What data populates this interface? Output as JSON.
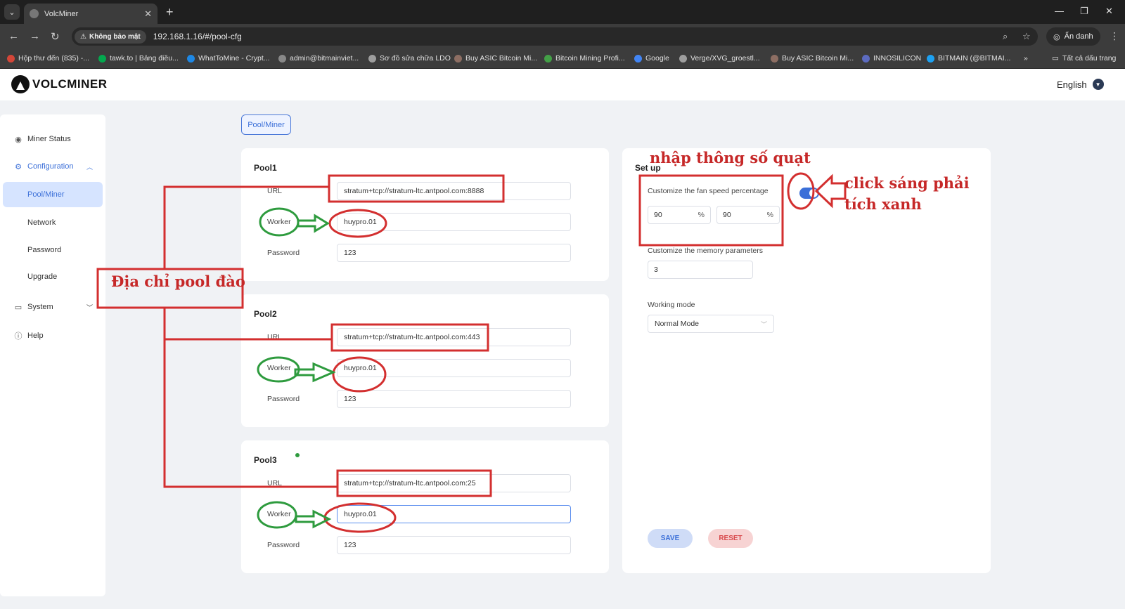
{
  "browser": {
    "tab_title": "VolcMiner",
    "tab_close": "✕",
    "new_tab": "+",
    "security_label": "Không bảo mật",
    "url": "192.168.1.16/#/pool-cfg",
    "incognito_label": "Ẩn danh",
    "bookmarks": [
      {
        "label": "Hộp thư đến (835) -...",
        "color": "#d44638"
      },
      {
        "label": "tawk.to | Bảng điều...",
        "color": "#03a84e"
      },
      {
        "label": "WhatToMine - Crypt...",
        "color": "#1e88e5"
      },
      {
        "label": "admin@bitmainviet...",
        "color": "#888888"
      },
      {
        "label": "Sơ đồ sửa chữa LDO",
        "color": "#9e9e9e"
      },
      {
        "label": "Buy ASIC Bitcoin Mi...",
        "color": "#8d6e63"
      },
      {
        "label": "Bitcoin Mining Profi...",
        "color": "#43a047"
      },
      {
        "label": "Google",
        "color": "#4285f4"
      },
      {
        "label": "Verge/XVG_groestl...",
        "color": "#9e9e9e"
      },
      {
        "label": "Buy ASIC Bitcoin Mi...",
        "color": "#8d6e63"
      },
      {
        "label": "INNOSILICON",
        "color": "#5c6bc0"
      },
      {
        "label": "BITMAIN (@BITMAI...",
        "color": "#1da1f2"
      }
    ],
    "bookmarks_more": "»",
    "all_bookmarks": "Tất cả dấu trang"
  },
  "header": {
    "logo": "VOLCMINER",
    "language": "English"
  },
  "sidebar": {
    "items": [
      {
        "label": "Miner Status"
      },
      {
        "label": "Configuration"
      },
      {
        "label": "Pool/Miner"
      },
      {
        "label": "Network"
      },
      {
        "label": "Password"
      },
      {
        "label": "Upgrade"
      },
      {
        "label": "System"
      },
      {
        "label": "Help"
      }
    ]
  },
  "main": {
    "tab": "Pool/Miner",
    "pools": [
      {
        "title": "Pool1",
        "url_label": "URL",
        "url": "stratum+tcp://stratum-ltc.antpool.com:8888",
        "worker_label": "Worker",
        "worker": "huypro.01",
        "password_label": "Password",
        "password": "123"
      },
      {
        "title": "Pool2",
        "url_label": "URL",
        "url": "stratum+tcp://stratum-ltc.antpool.com:443",
        "worker_label": "Worker",
        "worker": "huypro.01",
        "password_label": "Password",
        "password": "123"
      },
      {
        "title": "Pool3",
        "url_label": "URL",
        "url": "stratum+tcp://stratum-ltc.antpool.com:25",
        "worker_label": "Worker",
        "worker": "huypro.01",
        "password_label": "Password",
        "password": "123"
      }
    ],
    "setup": {
      "title": "Set up",
      "fan_label": "Customize the fan speed percentage",
      "fan_value_1": "90",
      "fan_value_2": "90",
      "percent": "%",
      "memory_label": "Customize the memory parameters",
      "memory_value": "3",
      "mode_label": "Working mode",
      "mode_value": "Normal Mode",
      "save": "SAVE",
      "reset": "RESET"
    }
  },
  "annotations": {
    "pool_address": "Địa chỉ pool đào",
    "fan_params": "nhập thông số quạt",
    "click_line1": "click sáng phải",
    "click_line2": "tích xanh"
  }
}
